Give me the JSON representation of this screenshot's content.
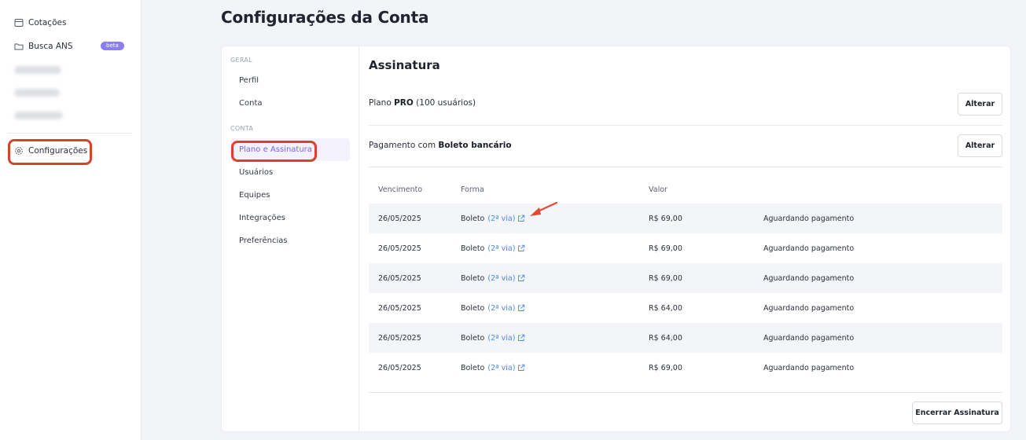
{
  "sidebar": {
    "items": [
      {
        "label": "Cotações",
        "icon": "window-icon"
      },
      {
        "label": "Busca ANS",
        "icon": "folder-icon",
        "badge": "beta"
      },
      {
        "label": "Configurações",
        "icon": "gear-icon"
      }
    ]
  },
  "page": {
    "title": "Configurações da Conta"
  },
  "settings_nav": {
    "sections": [
      {
        "title": "GERAL",
        "items": [
          "Perfil",
          "Conta"
        ]
      },
      {
        "title": "CONTA",
        "items": [
          "Plano e Assinatura",
          "Usuários",
          "Equipes",
          "Integrações",
          "Preferências"
        ]
      }
    ],
    "active": "Plano e Assinatura"
  },
  "subscription": {
    "title": "Assinatura",
    "plan_prefix": "Plano",
    "plan_name": "PRO",
    "plan_suffix": "(100 usuários)",
    "payment_prefix": "Pagamento com",
    "payment_method": "Boleto bancário",
    "change_label": "Alterar",
    "cancel_label": "Encerrar Assinatura"
  },
  "invoices": {
    "headers": [
      "Vencimento",
      "Forma",
      "Valor",
      ""
    ],
    "rows": [
      {
        "due": "26/05/2025",
        "method": "Boleto",
        "link": "(2ª via)",
        "value": "R$ 69,00",
        "status": "Aguardando pagamento"
      },
      {
        "due": "26/05/2025",
        "method": "Boleto",
        "link": "(2ª via)",
        "value": "R$ 69,00",
        "status": "Aguardando pagamento"
      },
      {
        "due": "26/05/2025",
        "method": "Boleto",
        "link": "(2ª via)",
        "value": "R$ 69,00",
        "status": "Aguardando pagamento"
      },
      {
        "due": "26/05/2025",
        "method": "Boleto",
        "link": "(2ª via)",
        "value": "R$ 64,00",
        "status": "Aguardando pagamento"
      },
      {
        "due": "26/05/2025",
        "method": "Boleto",
        "link": "(2ª via)",
        "value": "R$ 64,00",
        "status": "Aguardando pagamento"
      },
      {
        "due": "26/05/2025",
        "method": "Boleto",
        "link": "(2ª via)",
        "value": "R$ 69,00",
        "status": "Aguardando pagamento"
      }
    ]
  },
  "colors": {
    "accent": "#7b62e6",
    "link": "#4a8ae0",
    "highlight": "#d9412f",
    "badge": "#8b7ff0"
  }
}
